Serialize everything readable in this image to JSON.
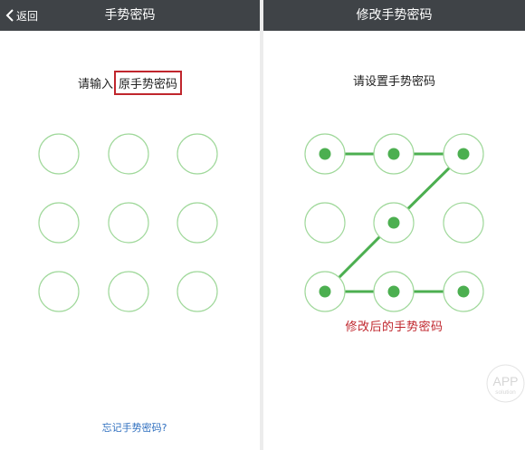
{
  "left_screen": {
    "back_label": "返回",
    "title": "手势密码",
    "prompt": "请输入",
    "prompt_highlight": "原手势密码",
    "forgot_link": "忘记手势密码?",
    "dot_count": 9
  },
  "right_screen": {
    "title": "修改手势密码",
    "prompt": "请设置手势密码",
    "caption": "修改后的手势密码",
    "pattern_sequence": [
      1,
      2,
      3,
      5,
      7,
      8,
      9
    ]
  },
  "watermark": {
    "line1": "APP",
    "line2": "solution"
  },
  "colors": {
    "navbar": "#3f4347",
    "ring": "#9fd89a",
    "selected_fill": "#4caf50",
    "line": "#4caf50",
    "highlight_border": "#c0262d",
    "caption": "#c0262d",
    "link": "#2f6fbf"
  }
}
